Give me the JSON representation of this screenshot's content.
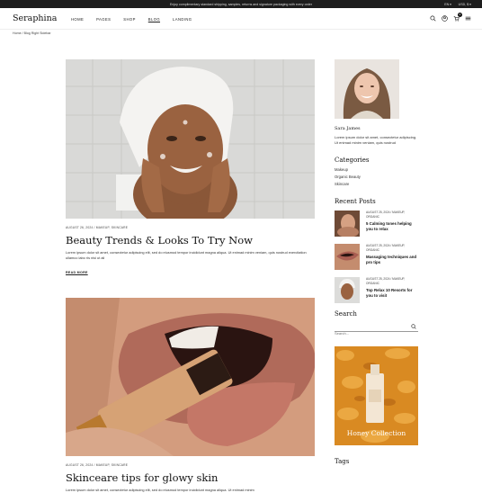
{
  "topbar": {
    "promo": "Enjoy complimentary standard shipping, samples, returns and signature packaging with every order",
    "lang": "EN",
    "currency": "USD, $"
  },
  "header": {
    "logo": "Seraphina",
    "nav": [
      "HOME",
      "PAGES",
      "SHOP",
      "BLOG",
      "LANDING"
    ],
    "cart_count": "0"
  },
  "breadcrumb": "Home / Blog Right Sidebar",
  "posts": [
    {
      "meta": "AUGUST 26, 2024 / MAKEUP, SKINCARE",
      "title": "Beauty Trends & Looks To Try Now",
      "excerpt": "Lorem ipsum dolor sit amet, consectetur adipiscing elit, sed do eiusmod tempor incididunt magna aliqua. Ut enimad minim veniam, quis nostrud exercitation ullamco labo ris nisi ut ali",
      "read_more": "READ MORE"
    },
    {
      "meta": "AUGUST 26, 2024 / MAKEUP, SKINCARE",
      "title": "Skinceare tips for glowy skin",
      "excerpt": "Lorem ipsum dolor sit amet, consectetur adipiscing elit, sed do eiusmod tempor incididunt magna aliqua. Ut enimad minim"
    }
  ],
  "sidebar": {
    "author": {
      "name": "Sara James",
      "bio": "Lorem ipsum dolor sit amet, consectetur adipiscing. Ut enimad minim veniam, quis nostrud"
    },
    "categories_title": "Categories",
    "categories": [
      "Makeup",
      "Organic Beauty",
      "Skincare"
    ],
    "recent_title": "Recent Posts",
    "recent": [
      {
        "meta": "AUGUST 25, 2024 / MAKEUP, ORGANIC",
        "title": "5 Calming tones helping you to relax"
      },
      {
        "meta": "AUGUST 25, 2024 / MAKEUP, ORGANIC",
        "title": "Massaging techniques and pro tips"
      },
      {
        "meta": "AUGUST 25, 2024 / MAKEUP, ORGANIC",
        "title": "Top Relax 10 Resorts for you to visit"
      }
    ],
    "search_title": "Search",
    "search_placeholder": "Search...",
    "banner_text": "Honey Collection",
    "tags_title": "Tags"
  }
}
